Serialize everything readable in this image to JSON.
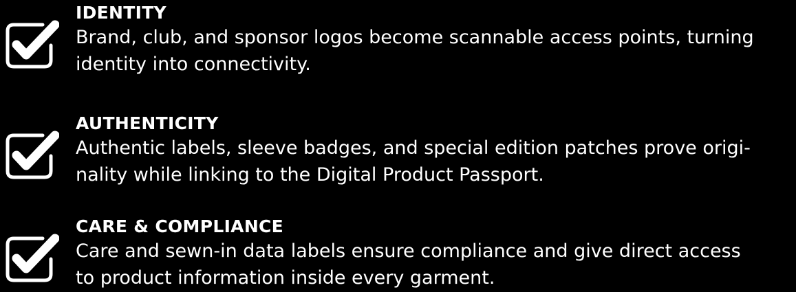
{
  "features": [
    {
      "icon": "checkbox-checked-icon",
      "title": "IDENTITY",
      "desc_lines": [
        "Brand, club, and sponsor logos become scannable access points, turning",
        "identity into connectivity."
      ]
    },
    {
      "icon": "checkbox-checked-icon",
      "title": "AUTHENTICITY",
      "desc_lines": [
        "Authentic labels, sleeve badges, and special edition patches prove origi-",
        "nality while linking to the Digital Product Passport."
      ]
    },
    {
      "icon": "checkbox-checked-icon",
      "title": "CARE & COMPLIANCE",
      "desc_lines": [
        "Care and sewn-in data labels ensure compliance and give direct access",
        "to product information inside every garment."
      ]
    }
  ],
  "colors": {
    "background": "#000000",
    "text": "#ffffff",
    "icon": "#ffffff"
  }
}
